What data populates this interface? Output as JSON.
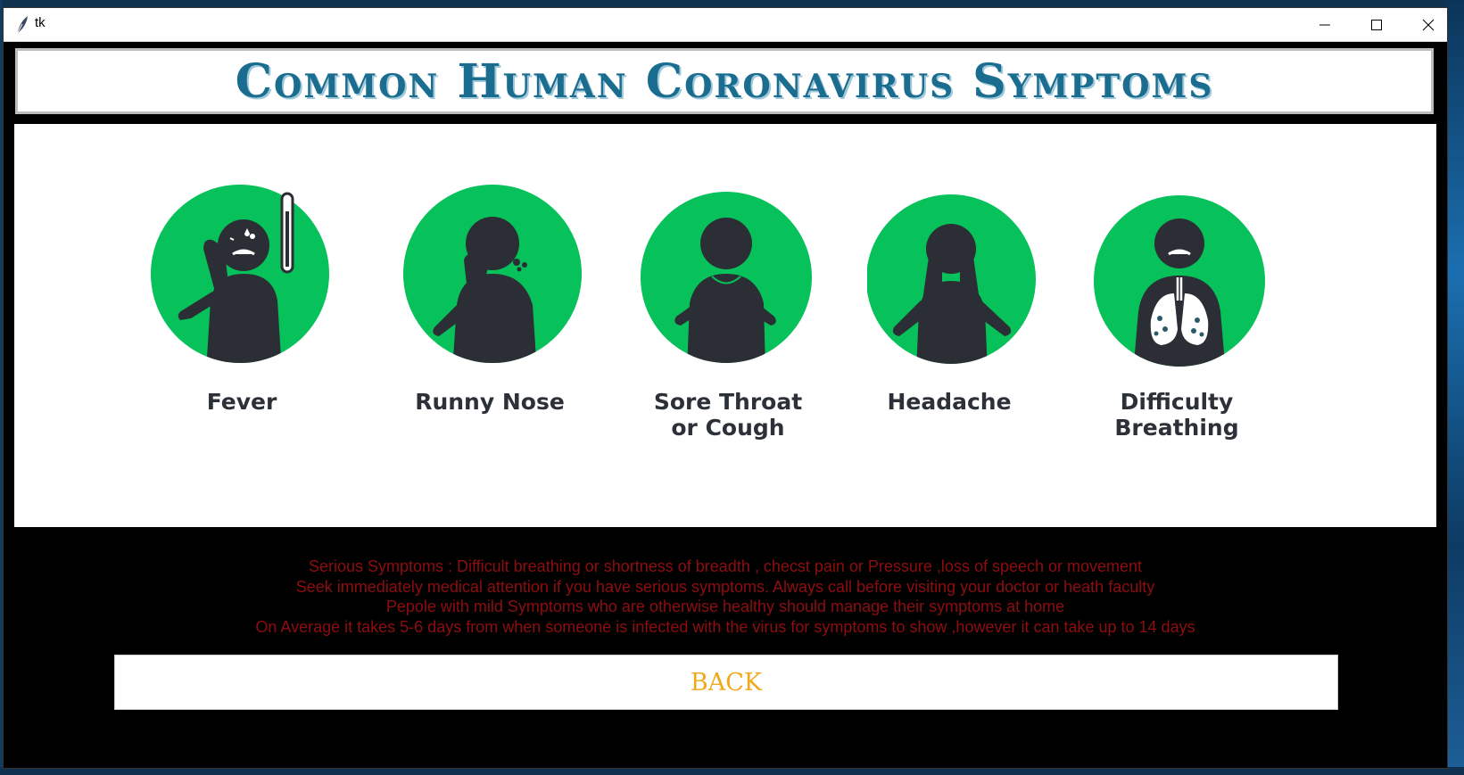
{
  "window": {
    "title": "tk",
    "controls": [
      "minimize",
      "maximize",
      "close"
    ]
  },
  "header": {
    "title": "Common Human Coronavirus Symptoms"
  },
  "symptoms": [
    {
      "label": "Fever",
      "icon": "fever-icon"
    },
    {
      "label": "Runny Nose",
      "icon": "runny-nose-icon"
    },
    {
      "label": "Sore Throat\nor Cough",
      "icon": "sore-throat-icon"
    },
    {
      "label": "Headache",
      "icon": "headache-icon"
    },
    {
      "label": "Difficulty Breathing",
      "icon": "difficulty-breathing-icon"
    }
  ],
  "info": {
    "lines": [
      "Serious Symptoms : Difficult breathing or shortness of breadth , checst pain or Pressure ,loss of speech or movement",
      "Seek immediately medical attention if you have serious symptoms. Always call before visiting your doctor or heath faculty",
      "Pepole with mild Symptoms who are otherwise healthy should manage their symptoms at home",
      "On Average it takes 5-6 days from when someone is infected with the virus for symptoms to show ,however it can take up to 14 days"
    ]
  },
  "back_button": {
    "label": "BACK"
  },
  "colors": {
    "icon_green": "#07c15a",
    "figure_dark": "#2b2e35",
    "info_red": "#8e0d10",
    "back_text": "#f0a91d",
    "title_blue": "#1b6d8f"
  }
}
